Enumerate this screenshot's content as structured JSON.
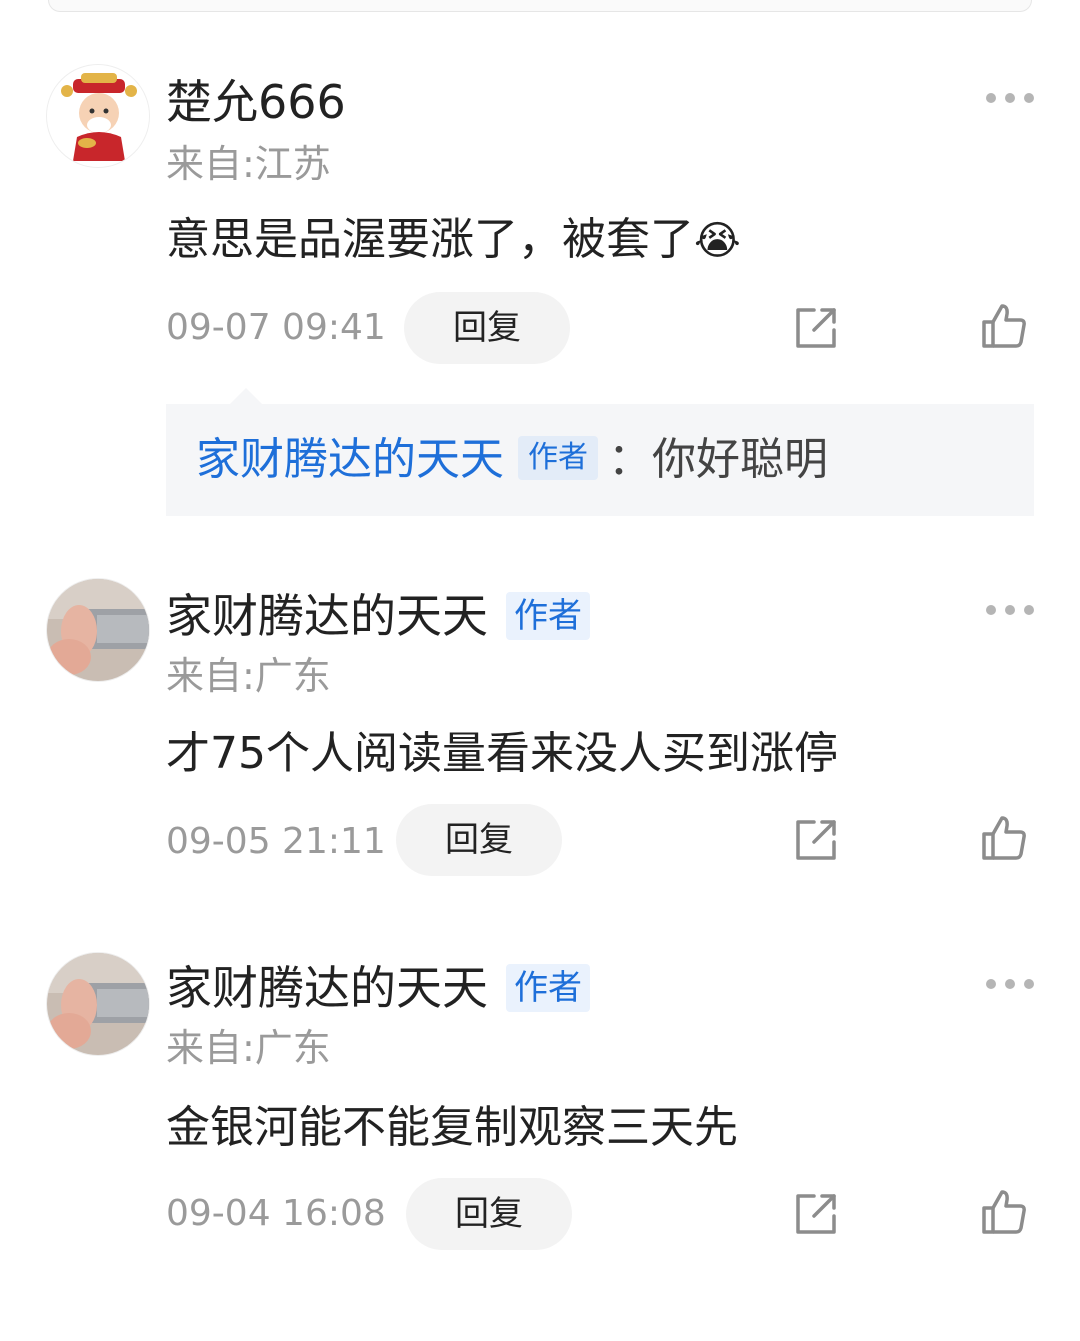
{
  "comments": [
    {
      "username": "楚允666",
      "is_author": false,
      "location": "来自:江苏",
      "text": "意思是品渥要涨了，被套了",
      "emoji": "😭",
      "time": "09-07 09:41",
      "reply_label": "回复",
      "sub_reply": {
        "name": "家财腾达的天天",
        "badge": "作者",
        "separator": "：",
        "text": "你好聪明"
      }
    },
    {
      "username": "家财腾达的天天",
      "is_author": true,
      "author_badge": "作者",
      "location": "来自:广东",
      "text": "才75个人阅读量看来没人买到涨停",
      "time": "09-05 21:11",
      "reply_label": "回复"
    },
    {
      "username": "家财腾达的天天",
      "is_author": true,
      "author_badge": "作者",
      "location": "来自:广东",
      "text": "金银河能不能复制观察三天先",
      "time": "09-04 16:08",
      "reply_label": "回复"
    }
  ],
  "icons": {
    "more": "more-dots-icon",
    "share": "share-icon",
    "like": "thumbs-up-icon"
  },
  "colors": {
    "author_blue": "#1e6fd9",
    "secondary_text": "#9a9a9a"
  }
}
